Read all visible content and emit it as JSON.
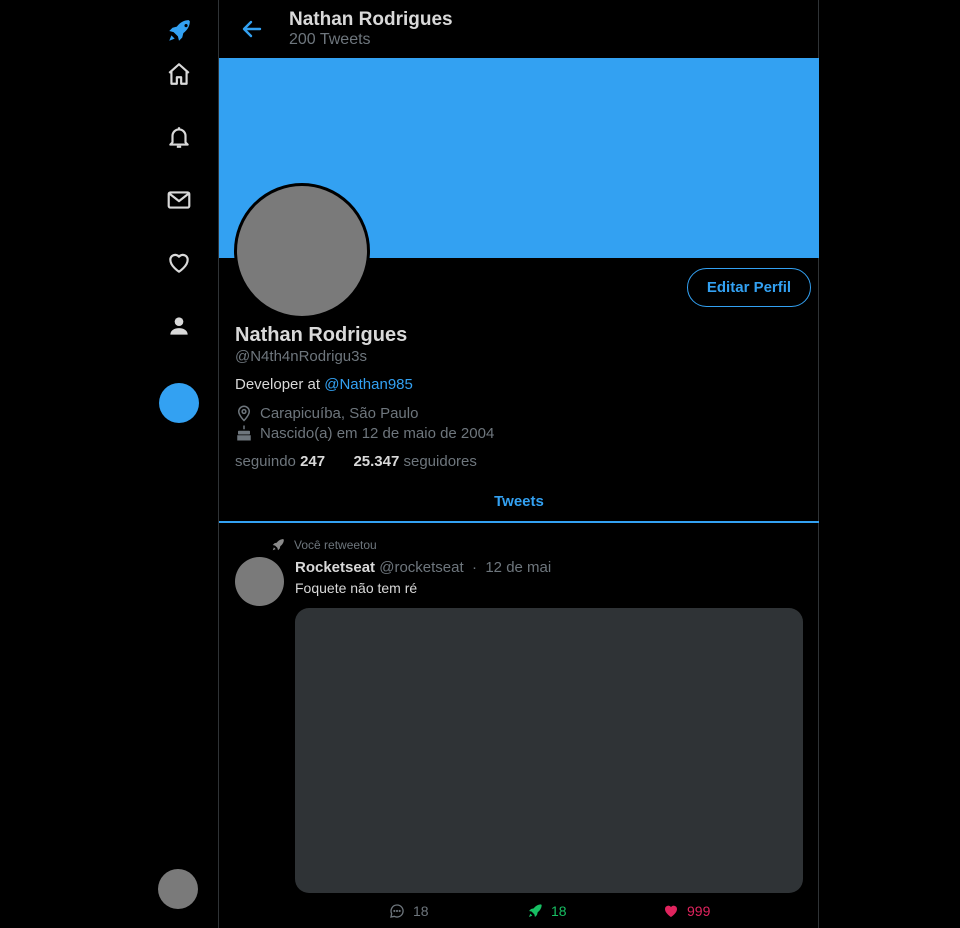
{
  "colors": {
    "accent": "#33a1f2",
    "background": "#000000",
    "retweet": "#17bf63",
    "like": "#e0245e",
    "muted": "#6e767d"
  },
  "sidebar": {
    "icons": [
      "rocket-logo-icon",
      "home-icon",
      "bell-icon",
      "mail-icon",
      "heart-icon",
      "user-icon"
    ]
  },
  "header": {
    "title": "Nathan Rodrigues",
    "tweet_count": "200 Tweets"
  },
  "profile": {
    "name": "Nathan Rodrigues",
    "handle": "@N4th4nRodrigu3s",
    "bio_prefix": "Developer at ",
    "bio_link": "@Nathan985",
    "location": "Carapicuíba, São Paulo",
    "birth": "Nascido(a) em 12 de maio de 2004",
    "following_label": "seguindo",
    "following_count": "247",
    "followers_count": "25.347",
    "followers_label": "seguidores",
    "edit_button": "Editar Perfil"
  },
  "tabs": {
    "active": "Tweets"
  },
  "tweet": {
    "retweet_label": "Você retweetou",
    "author_name": "Rocketseat",
    "author_handle": "@rocketseat",
    "separator": "·",
    "date": "12 de mai",
    "text": "Foquete não tem ré",
    "replies": "18",
    "retweets": "18",
    "likes": "999"
  }
}
